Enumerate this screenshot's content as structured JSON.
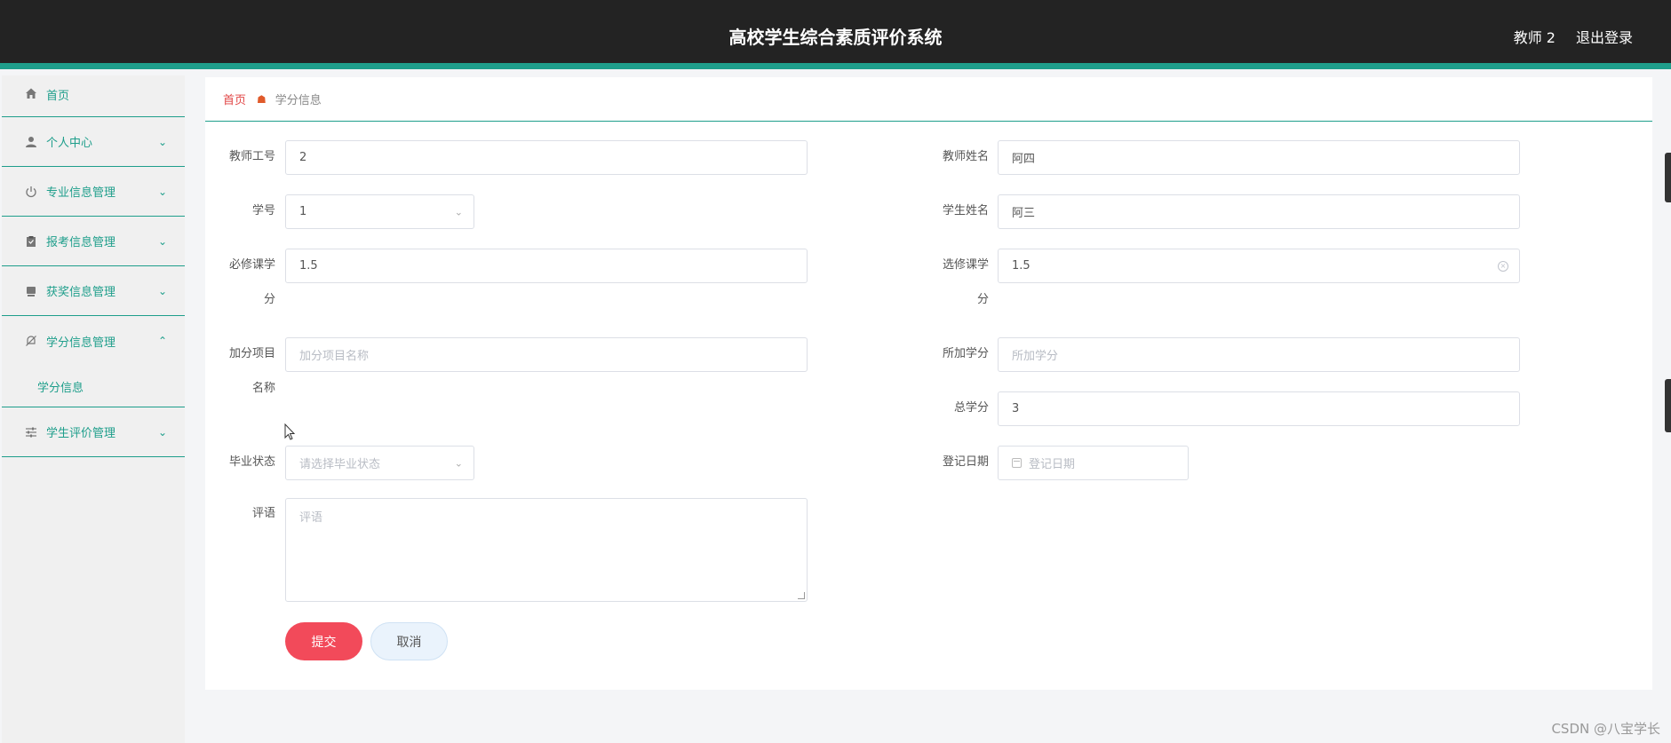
{
  "header": {
    "title": "高校学生综合素质评价系统",
    "user": "教师 2",
    "logout": "退出登录"
  },
  "sidebar": {
    "home": "首页",
    "items": [
      {
        "label": "个人中心",
        "icon": "user-icon"
      },
      {
        "label": "专业信息管理",
        "icon": "power-icon"
      },
      {
        "label": "报考信息管理",
        "icon": "clipboard-icon"
      },
      {
        "label": "获奖信息管理",
        "icon": "trophy-icon"
      },
      {
        "label": "学分信息管理",
        "icon": "bell-off-icon"
      },
      {
        "label": "学生评价管理",
        "icon": "sliders-icon"
      }
    ],
    "sub_items": [
      "学分信息"
    ]
  },
  "breadcrumb": {
    "home": "首页",
    "current": "学分信息"
  },
  "form": {
    "teacher_id": {
      "label": "教师工号",
      "value": "2"
    },
    "teacher_name": {
      "label": "教师姓名",
      "value": "阿四"
    },
    "student_id": {
      "label": "学号",
      "value": "1"
    },
    "student_name": {
      "label": "学生姓名",
      "value": "阿三"
    },
    "required_credits": {
      "label_1": "必修课学",
      "label_2": "分",
      "value": "1.5"
    },
    "elective_credits": {
      "label_1": "选修课学",
      "label_2": "分",
      "value": "1.5"
    },
    "bonus_item": {
      "label_1": "加分项目",
      "label_2": "名称",
      "placeholder": "加分项目名称"
    },
    "bonus_credits": {
      "label": "所加学分",
      "placeholder": "所加学分"
    },
    "total_credits": {
      "label": "总学分",
      "value": "3"
    },
    "graduation_status": {
      "label": "毕业状态",
      "placeholder": "请选择毕业状态"
    },
    "register_date": {
      "label": "登记日期",
      "placeholder": "登记日期"
    },
    "comment": {
      "label": "评语",
      "placeholder": "评语"
    },
    "submit": "提交",
    "cancel": "取消"
  },
  "watermark": "CSDN @八宝学长"
}
